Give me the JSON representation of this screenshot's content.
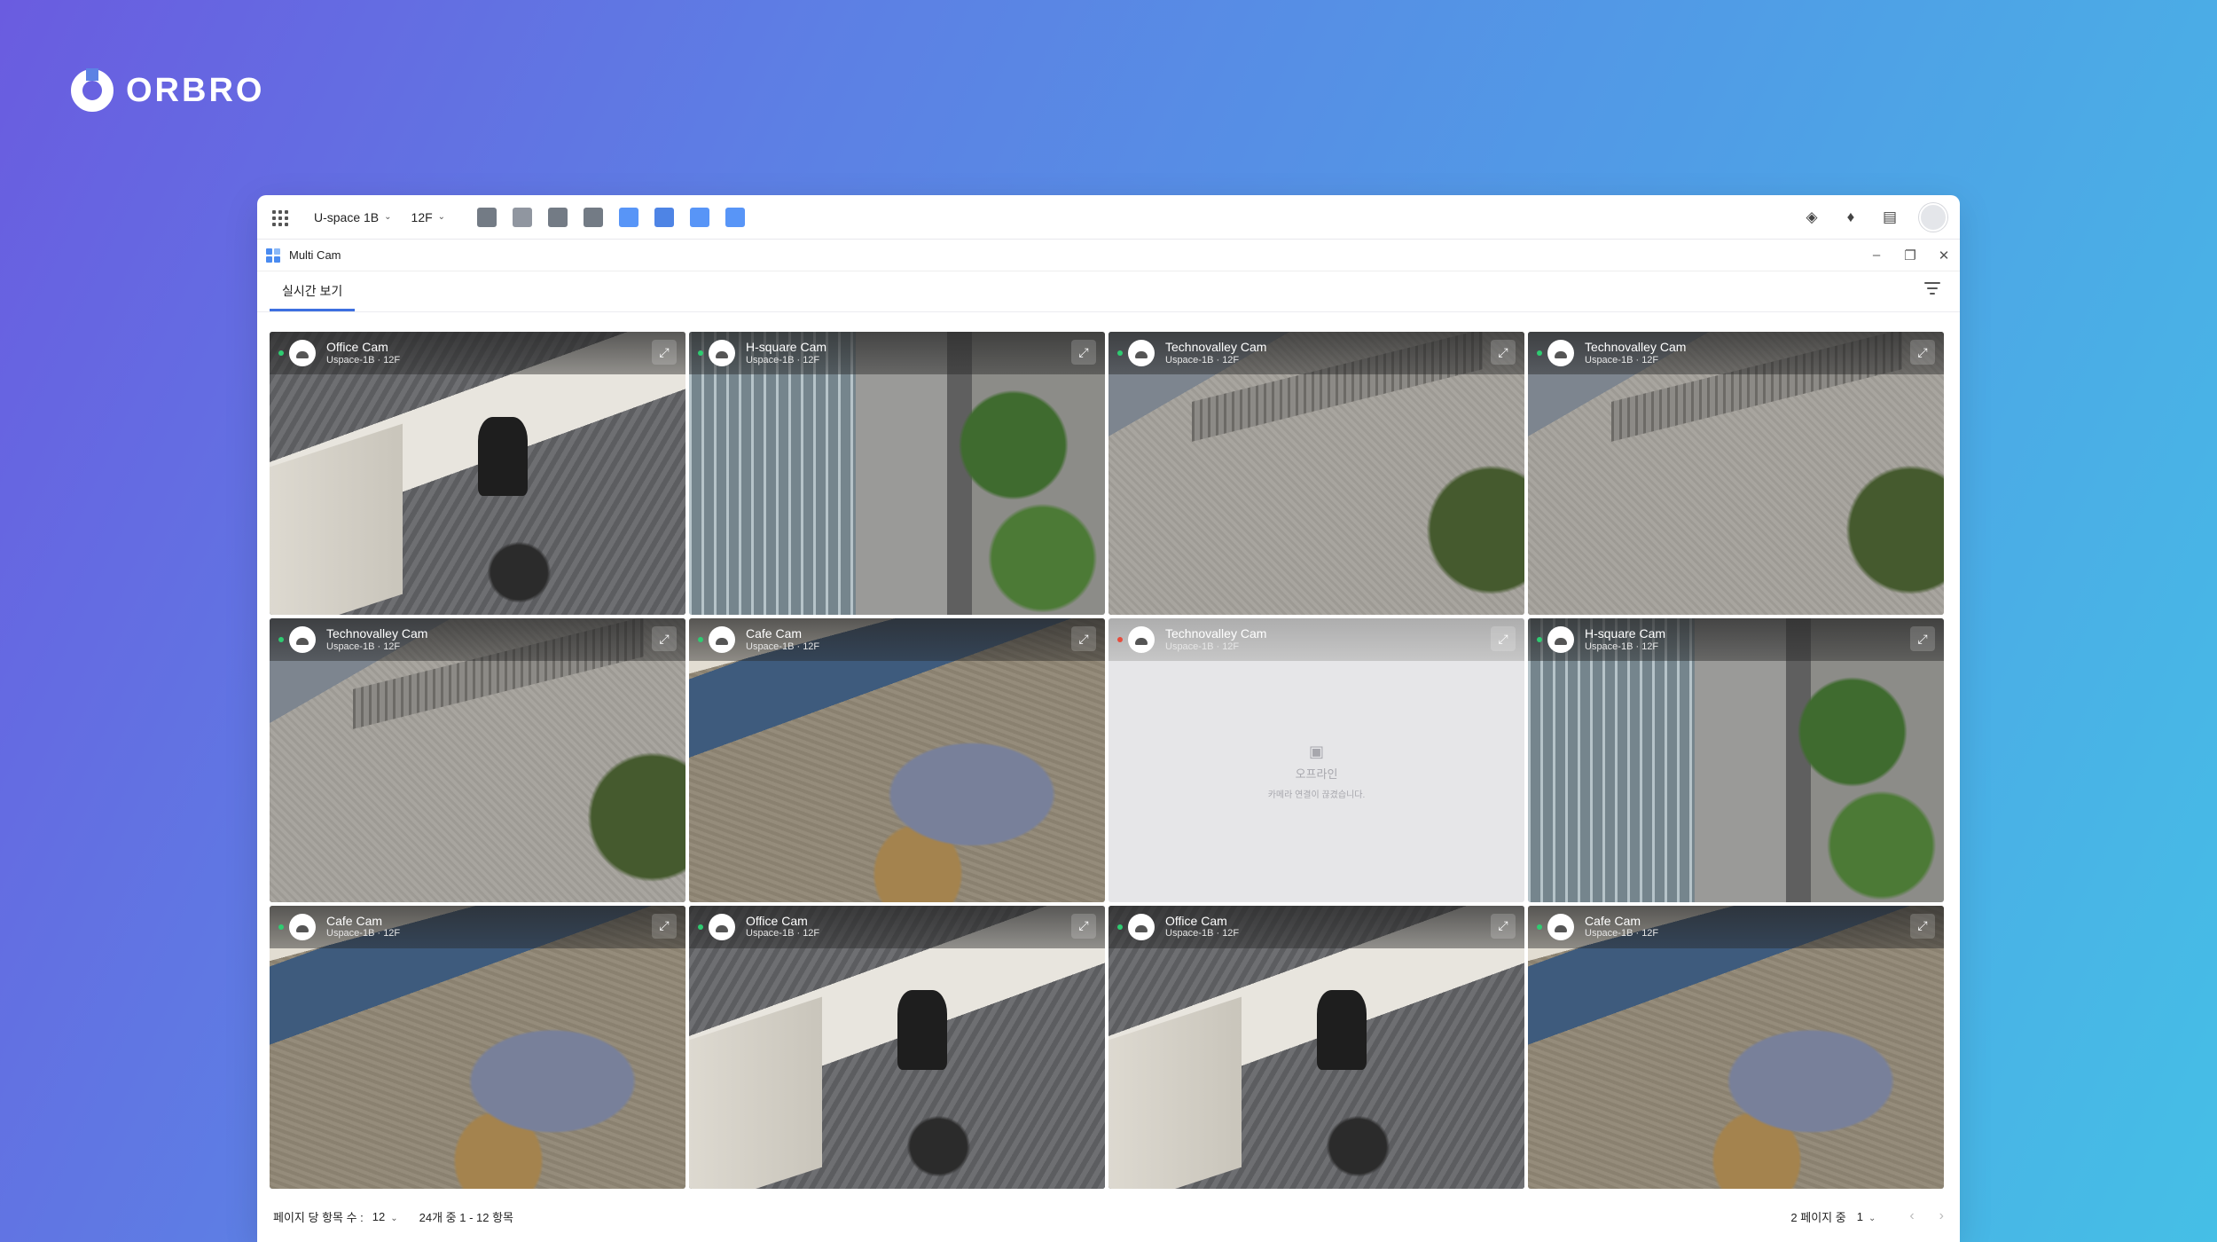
{
  "brand": {
    "name": "ORBRO"
  },
  "topbar": {
    "space": "U-space 1B",
    "floor": "12F",
    "tools": [
      {
        "icon": "layout-icon",
        "color": "#5b6470"
      },
      {
        "icon": "cube-icon",
        "color": "#7c848f"
      },
      {
        "icon": "dashboard-icon",
        "color": "#5b6470"
      },
      {
        "icon": "settings-icon",
        "color": "#5b6470"
      },
      {
        "icon": "analytics-icon",
        "color": "#3b82f6"
      },
      {
        "icon": "layers-icon",
        "color": "#2f6fe0"
      },
      {
        "icon": "chat-icon",
        "color": "#3b82f6"
      },
      {
        "icon": "multicam-icon",
        "color": "#3b82f6"
      }
    ]
  },
  "panel": {
    "title": "Multi Cam"
  },
  "tabs": [
    {
      "label": "실시간 보기",
      "active": true
    }
  ],
  "cameras": [
    {
      "name": "Office Cam",
      "location": "Uspace-1B · 12F",
      "status": "online",
      "scene": "office"
    },
    {
      "name": "H-square Cam",
      "location": "Uspace-1B · 12F",
      "status": "online",
      "scene": "tower"
    },
    {
      "name": "Technovalley Cam",
      "location": "Uspace-1B · 12F",
      "status": "online",
      "scene": "plaza"
    },
    {
      "name": "Technovalley Cam",
      "location": "Uspace-1B · 12F",
      "status": "online",
      "scene": "plaza"
    },
    {
      "name": "Technovalley Cam",
      "location": "Uspace-1B · 12F",
      "status": "online",
      "scene": "plaza"
    },
    {
      "name": "Cafe Cam",
      "location": "Uspace-1B · 12F",
      "status": "online",
      "scene": "cafe"
    },
    {
      "name": "Technovalley Cam",
      "location": "Uspace-1B · 12F",
      "status": "offline",
      "scene": "offline"
    },
    {
      "name": "H-square Cam",
      "location": "Uspace-1B · 12F",
      "status": "online",
      "scene": "tower"
    },
    {
      "name": "Cafe Cam",
      "location": "Uspace-1B · 12F",
      "status": "online",
      "scene": "cafe"
    },
    {
      "name": "Office Cam",
      "location": "Uspace-1B · 12F",
      "status": "online",
      "scene": "office"
    },
    {
      "name": "Office Cam",
      "location": "Uspace-1B · 12F",
      "status": "online",
      "scene": "office"
    },
    {
      "name": "Cafe Cam",
      "location": "Uspace-1B · 12F",
      "status": "online",
      "scene": "cafe"
    }
  ],
  "offline": {
    "title": "오프라인",
    "subtitle": "카메라 연결이 끊겼습니다."
  },
  "footer": {
    "per_page_label": "페이지 당 항목 수 :",
    "per_page_value": "12",
    "range_text": "24개 중 1 - 12 항목",
    "pages_text": "2 페이지 중",
    "current_page": "1"
  }
}
